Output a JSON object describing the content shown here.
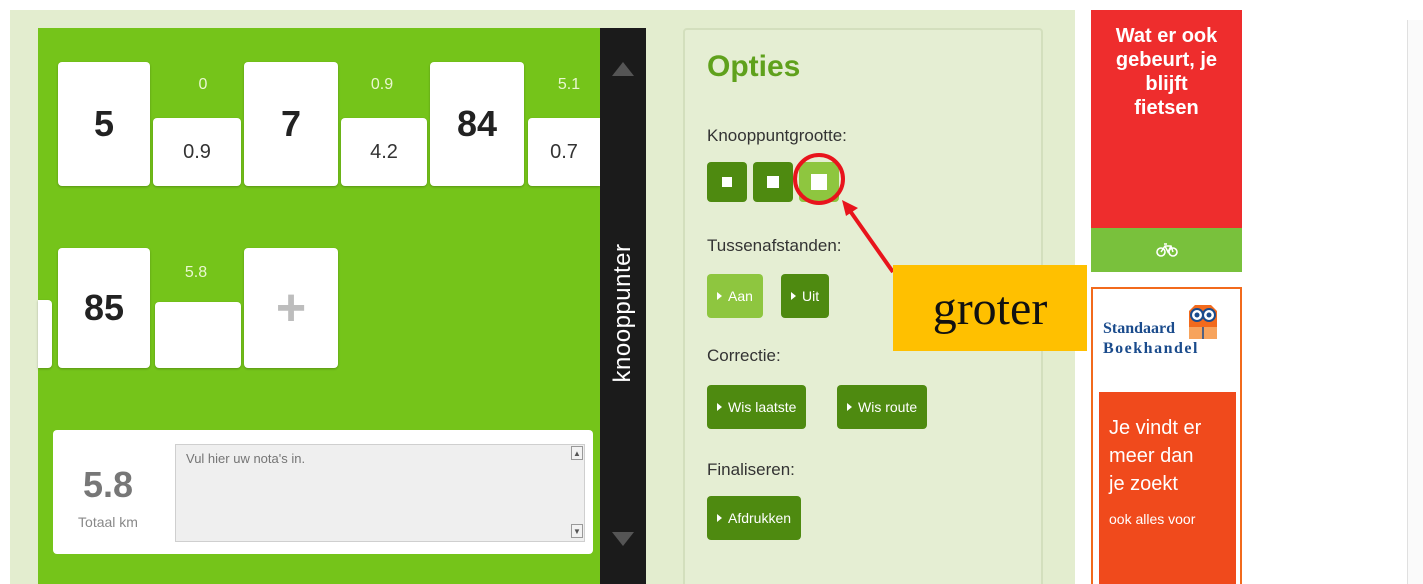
{
  "route": {
    "nodes_row1": [
      {
        "node": "5",
        "cumulative": "0",
        "distance": "0.9"
      },
      {
        "node": "7",
        "cumulative": "0.9",
        "distance": "4.2"
      },
      {
        "node": "84",
        "cumulative": "5.1",
        "distance": "0.7"
      }
    ],
    "nodes_row2": [
      {
        "node": "85",
        "cumulative": "5.8",
        "distance": ""
      }
    ],
    "add_symbol": "+"
  },
  "notes": {
    "total_value": "5.8",
    "total_label": "Totaal km",
    "placeholder": "Vul hier uw nota's in."
  },
  "sidebar_tab": {
    "label": "knooppunter"
  },
  "options": {
    "title": "Opties",
    "size_heading": "Knooppuntgrootte:",
    "spacing_heading": "Tussenafstanden:",
    "spacing_on": "Aan",
    "spacing_off": "Uit",
    "correction_heading": "Correctie:",
    "clear_last": "Wis laatste",
    "clear_route": "Wis route",
    "finalize_heading": "Finaliseren:",
    "print": "Afdrukken"
  },
  "ads": {
    "bike_ad_text": "Wat er ook gebeurt, je blijft fietsen",
    "bookstore_name_line1": "Standaard",
    "bookstore_name_line2": "Boekhandel",
    "bookstore_slogan": "Je vindt er meer dan je zoekt",
    "bookstore_small": "ook alles voor"
  },
  "annotation": {
    "label": "groter"
  },
  "colors": {
    "route_green": "#75c41a",
    "button_green": "#4e8a10",
    "active_green": "#8ec63f",
    "annotation_red": "#e8141c",
    "annotation_yellow": "#ffc000"
  },
  "icons": {
    "bike": "bicycle-icon",
    "owl": "owl-logo"
  }
}
